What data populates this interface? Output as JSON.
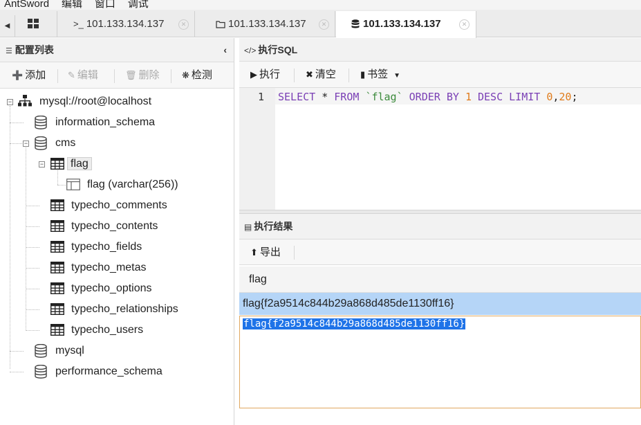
{
  "menu": [
    "AntSword",
    "编辑",
    "窗口",
    "调试"
  ],
  "tabs": [
    {
      "label": "101.133.134.137",
      "icon": ">_"
    },
    {
      "label": "101.133.134.137",
      "icon": "folder"
    },
    {
      "label": "101.133.134.137",
      "icon": "database"
    }
  ],
  "left_panel": {
    "title": "配置列表",
    "toolbar": {
      "add": "添加",
      "edit": "编辑",
      "delete": "删除",
      "detect": "检测"
    },
    "tree": {
      "root": "mysql://root@localhost",
      "databases": [
        "information_schema",
        "cms",
        "mysql",
        "performance_schema"
      ],
      "selected_table": "flag",
      "column": "flag (varchar(256))",
      "tables": [
        "typecho_comments",
        "typecho_contents",
        "typecho_fields",
        "typecho_metas",
        "typecho_options",
        "typecho_relationships",
        "typecho_users"
      ]
    }
  },
  "sql_panel": {
    "title": "执行SQL",
    "toolbar": {
      "execute": "执行",
      "clear": "清空",
      "bookmark": "书签"
    },
    "line_number": "1",
    "code": {
      "k1": "SELECT",
      "star": " * ",
      "k2": "FROM",
      "tbl": "`flag`",
      "k3": "ORDER BY",
      "n1": "1",
      "k4": "DESC",
      "k5": "LIMIT",
      "n2": "0",
      "comma": ",",
      "n3": "20",
      "end": ";"
    }
  },
  "result_panel": {
    "title": "执行结果",
    "toolbar": {
      "export": "导出"
    },
    "column_header": "flag",
    "row_value": "flag{f2a9514c844b29a868d485de1130ff16}",
    "detail_text": "flag{f2a9514c844b29a868d485de1130ff16}"
  }
}
